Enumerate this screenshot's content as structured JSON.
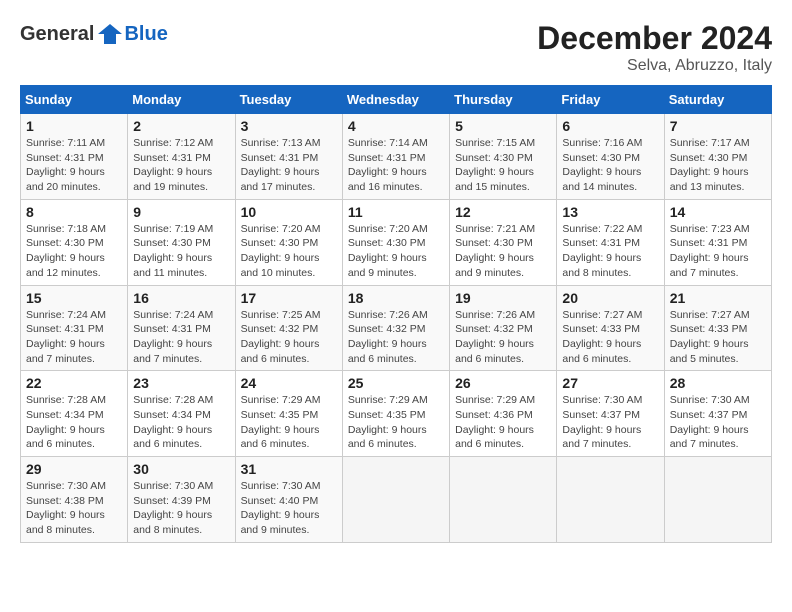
{
  "header": {
    "logo_general": "General",
    "logo_blue": "Blue",
    "month_title": "December 2024",
    "location": "Selva, Abruzzo, Italy"
  },
  "weekdays": [
    "Sunday",
    "Monday",
    "Tuesday",
    "Wednesday",
    "Thursday",
    "Friday",
    "Saturday"
  ],
  "weeks": [
    [
      {
        "day": "1",
        "info": "Sunrise: 7:11 AM\nSunset: 4:31 PM\nDaylight: 9 hours\nand 20 minutes."
      },
      {
        "day": "2",
        "info": "Sunrise: 7:12 AM\nSunset: 4:31 PM\nDaylight: 9 hours\nand 19 minutes."
      },
      {
        "day": "3",
        "info": "Sunrise: 7:13 AM\nSunset: 4:31 PM\nDaylight: 9 hours\nand 17 minutes."
      },
      {
        "day": "4",
        "info": "Sunrise: 7:14 AM\nSunset: 4:31 PM\nDaylight: 9 hours\nand 16 minutes."
      },
      {
        "day": "5",
        "info": "Sunrise: 7:15 AM\nSunset: 4:30 PM\nDaylight: 9 hours\nand 15 minutes."
      },
      {
        "day": "6",
        "info": "Sunrise: 7:16 AM\nSunset: 4:30 PM\nDaylight: 9 hours\nand 14 minutes."
      },
      {
        "day": "7",
        "info": "Sunrise: 7:17 AM\nSunset: 4:30 PM\nDaylight: 9 hours\nand 13 minutes."
      }
    ],
    [
      {
        "day": "8",
        "info": "Sunrise: 7:18 AM\nSunset: 4:30 PM\nDaylight: 9 hours\nand 12 minutes."
      },
      {
        "day": "9",
        "info": "Sunrise: 7:19 AM\nSunset: 4:30 PM\nDaylight: 9 hours\nand 11 minutes."
      },
      {
        "day": "10",
        "info": "Sunrise: 7:20 AM\nSunset: 4:30 PM\nDaylight: 9 hours\nand 10 minutes."
      },
      {
        "day": "11",
        "info": "Sunrise: 7:20 AM\nSunset: 4:30 PM\nDaylight: 9 hours\nand 9 minutes."
      },
      {
        "day": "12",
        "info": "Sunrise: 7:21 AM\nSunset: 4:30 PM\nDaylight: 9 hours\nand 9 minutes."
      },
      {
        "day": "13",
        "info": "Sunrise: 7:22 AM\nSunset: 4:31 PM\nDaylight: 9 hours\nand 8 minutes."
      },
      {
        "day": "14",
        "info": "Sunrise: 7:23 AM\nSunset: 4:31 PM\nDaylight: 9 hours\nand 7 minutes."
      }
    ],
    [
      {
        "day": "15",
        "info": "Sunrise: 7:24 AM\nSunset: 4:31 PM\nDaylight: 9 hours\nand 7 minutes."
      },
      {
        "day": "16",
        "info": "Sunrise: 7:24 AM\nSunset: 4:31 PM\nDaylight: 9 hours\nand 7 minutes."
      },
      {
        "day": "17",
        "info": "Sunrise: 7:25 AM\nSunset: 4:32 PM\nDaylight: 9 hours\nand 6 minutes."
      },
      {
        "day": "18",
        "info": "Sunrise: 7:26 AM\nSunset: 4:32 PM\nDaylight: 9 hours\nand 6 minutes."
      },
      {
        "day": "19",
        "info": "Sunrise: 7:26 AM\nSunset: 4:32 PM\nDaylight: 9 hours\nand 6 minutes."
      },
      {
        "day": "20",
        "info": "Sunrise: 7:27 AM\nSunset: 4:33 PM\nDaylight: 9 hours\nand 6 minutes."
      },
      {
        "day": "21",
        "info": "Sunrise: 7:27 AM\nSunset: 4:33 PM\nDaylight: 9 hours\nand 5 minutes."
      }
    ],
    [
      {
        "day": "22",
        "info": "Sunrise: 7:28 AM\nSunset: 4:34 PM\nDaylight: 9 hours\nand 6 minutes."
      },
      {
        "day": "23",
        "info": "Sunrise: 7:28 AM\nSunset: 4:34 PM\nDaylight: 9 hours\nand 6 minutes."
      },
      {
        "day": "24",
        "info": "Sunrise: 7:29 AM\nSunset: 4:35 PM\nDaylight: 9 hours\nand 6 minutes."
      },
      {
        "day": "25",
        "info": "Sunrise: 7:29 AM\nSunset: 4:35 PM\nDaylight: 9 hours\nand 6 minutes."
      },
      {
        "day": "26",
        "info": "Sunrise: 7:29 AM\nSunset: 4:36 PM\nDaylight: 9 hours\nand 6 minutes."
      },
      {
        "day": "27",
        "info": "Sunrise: 7:30 AM\nSunset: 4:37 PM\nDaylight: 9 hours\nand 7 minutes."
      },
      {
        "day": "28",
        "info": "Sunrise: 7:30 AM\nSunset: 4:37 PM\nDaylight: 9 hours\nand 7 minutes."
      }
    ],
    [
      {
        "day": "29",
        "info": "Sunrise: 7:30 AM\nSunset: 4:38 PM\nDaylight: 9 hours\nand 8 minutes."
      },
      {
        "day": "30",
        "info": "Sunrise: 7:30 AM\nSunset: 4:39 PM\nDaylight: 9 hours\nand 8 minutes."
      },
      {
        "day": "31",
        "info": "Sunrise: 7:30 AM\nSunset: 4:40 PM\nDaylight: 9 hours\nand 9 minutes."
      },
      null,
      null,
      null,
      null
    ]
  ]
}
